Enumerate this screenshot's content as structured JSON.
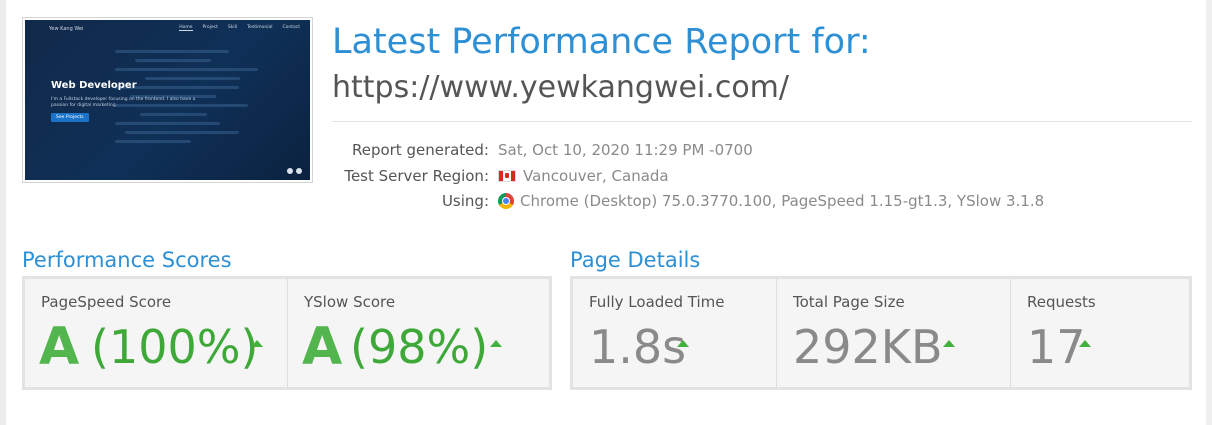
{
  "thumbnail": {
    "site_name": "Yew Kang Wei",
    "nav": [
      "Home",
      "Project",
      "Skill",
      "Testimonial",
      "Contact"
    ],
    "hero_title": "Web Developer",
    "hero_subtitle": "I'm a Fullstack developer focusing on the frontend. I also have a passion for digital marketing.",
    "hero_button": "See Projects"
  },
  "header": {
    "title": "Latest Performance Report for:",
    "url": "https://www.yewkangwei.com/"
  },
  "meta": {
    "report_generated_label": "Report generated:",
    "report_generated_value": "Sat, Oct 10, 2020 11:29 PM -0700",
    "region_label": "Test Server Region:",
    "region_value": "Vancouver, Canada",
    "using_label": "Using:",
    "using_value": "Chrome (Desktop) 75.0.3770.100, PageSpeed 1.15-gt1.3, YSlow 3.1.8"
  },
  "performance": {
    "title": "Performance Scores",
    "pagespeed": {
      "label": "PageSpeed Score",
      "grade": "A",
      "percent": "(100%)"
    },
    "yslow": {
      "label": "YSlow Score",
      "grade": "A",
      "percent": "(98%)"
    }
  },
  "details": {
    "title": "Page Details",
    "load_time": {
      "label": "Fully Loaded Time",
      "value": "1.8s"
    },
    "page_size": {
      "label": "Total Page Size",
      "value": "292KB"
    },
    "requests": {
      "label": "Requests",
      "value": "17"
    }
  },
  "colors": {
    "accent": "#2d8fd4",
    "grade_green": "#53b54d",
    "trend_green": "#44b03d"
  },
  "icons": [
    "canada-flag-icon",
    "chrome-icon",
    "trend-up-icon"
  ]
}
